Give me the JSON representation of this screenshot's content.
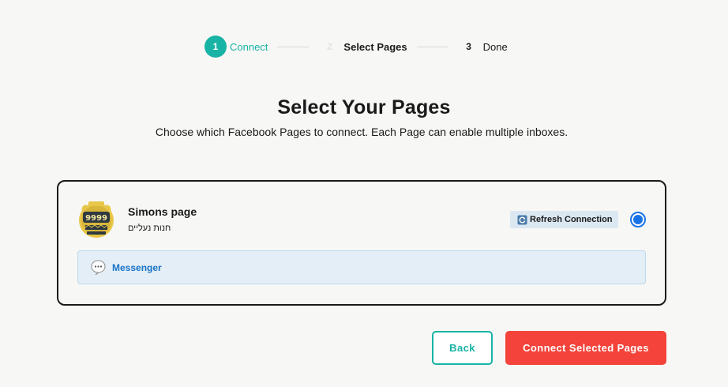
{
  "stepper": {
    "steps": [
      {
        "num": "1",
        "label": "Connect",
        "state": "active"
      },
      {
        "num": "2",
        "label": "Select Pages",
        "state": "current"
      },
      {
        "num": "3",
        "label": "Done",
        "state": "upcoming"
      }
    ]
  },
  "heading": {
    "title": "Select Your Pages",
    "subtitle": "Choose which Facebook Pages to connect. Each Page can enable multiple inboxes."
  },
  "page_card": {
    "avatar_text": "9999",
    "name": "Simons page",
    "category": "חנות נעליים",
    "refresh_label": "Refresh Connection",
    "selected": true,
    "inbox_label": "Messenger"
  },
  "actions": {
    "back_label": "Back",
    "connect_label": "Connect Selected Pages"
  },
  "colors": {
    "accent": "#17b3a5",
    "primary_action": "#f3433a",
    "radio": "#1873e8",
    "inbox_bg": "#e3eef6"
  }
}
